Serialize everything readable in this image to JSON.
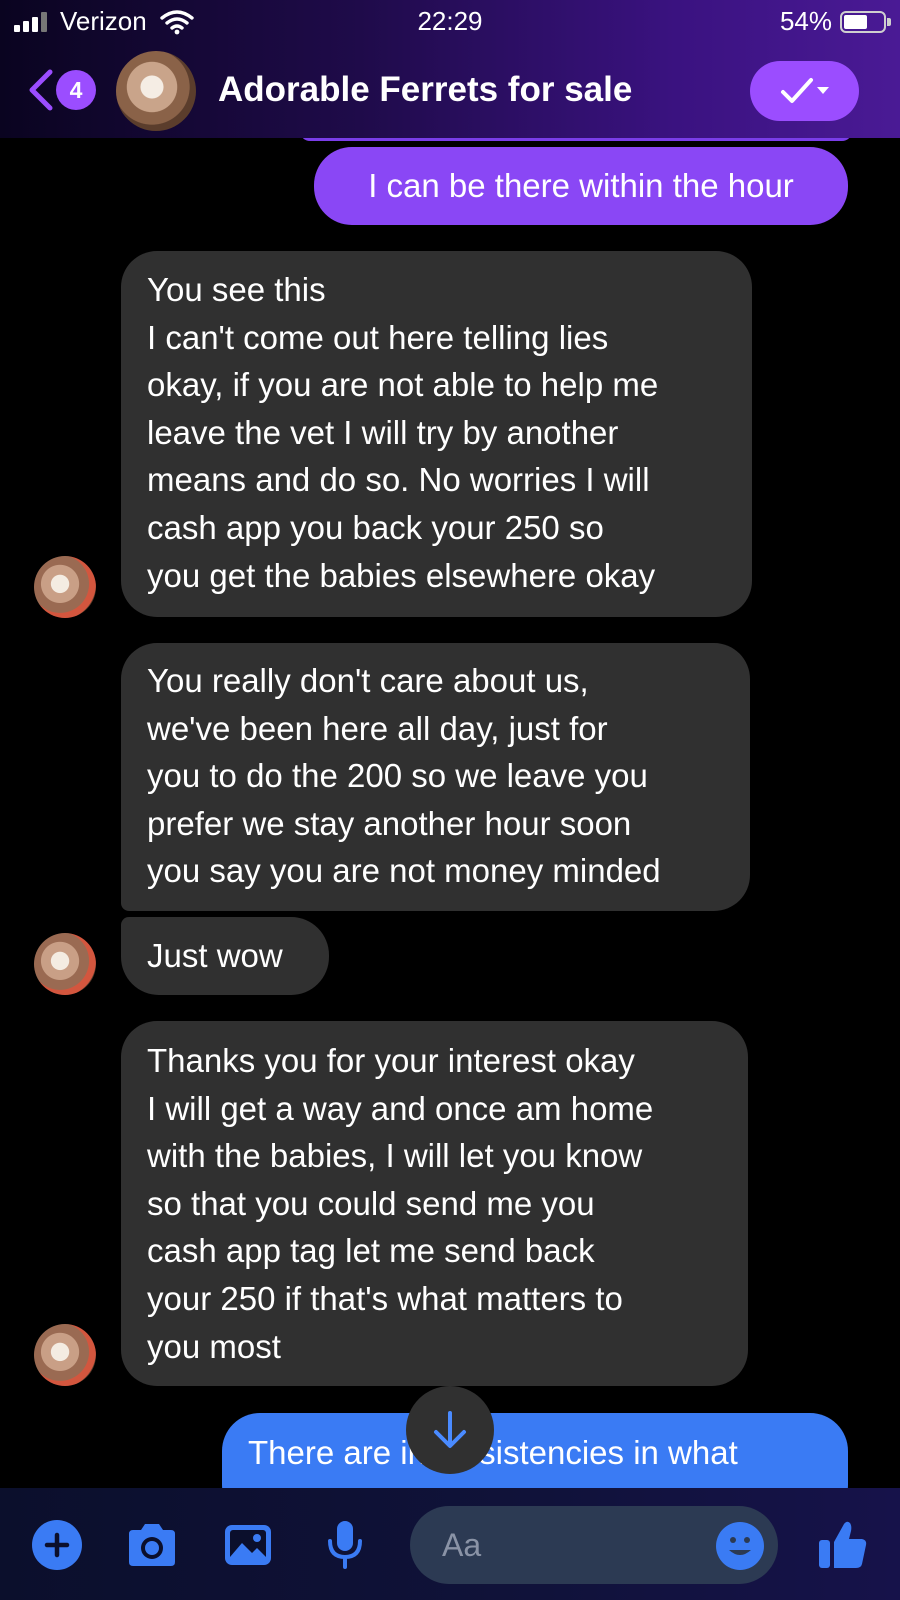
{
  "status_bar": {
    "carrier": "Verizon",
    "time": "22:29",
    "battery_percent": "54%"
  },
  "header": {
    "back_badge_count": "4",
    "title": "Adorable Ferrets for sale"
  },
  "messages": [
    {
      "direction": "out",
      "text": "I can be there within the hour"
    },
    {
      "direction": "in",
      "text": "You see this\nI can't come out here telling lies\nokay, if you are not able to help me\nleave the vet I will try by another\nmeans and do so. No worries I will\ncash app you back your 250 so\nyou get the babies elsewhere okay"
    },
    {
      "direction": "in",
      "text": "You really don't care about us,\nwe've been here all day, just for\nyou to do the 200 so we leave you\nprefer we stay another hour soon\nyou say you are not money minded"
    },
    {
      "direction": "in",
      "text": "Just wow"
    },
    {
      "direction": "in",
      "text": "Thanks you for your interest okay\nI will get a way and once am home\nwith the babies, I will let you know\nso that you could send me you\ncash app tag let me send back\nyour 250 if that's what matters to\nyou most"
    },
    {
      "direction": "out",
      "text": "There are inconsistencies in what"
    }
  ],
  "composer": {
    "placeholder": "Aa"
  },
  "colors": {
    "accent_purple": "#9b4dff",
    "outgoing_bubble": "#8a47f5",
    "incoming_bubble": "#303030",
    "outgoing_blue": "#3a7bf4"
  }
}
